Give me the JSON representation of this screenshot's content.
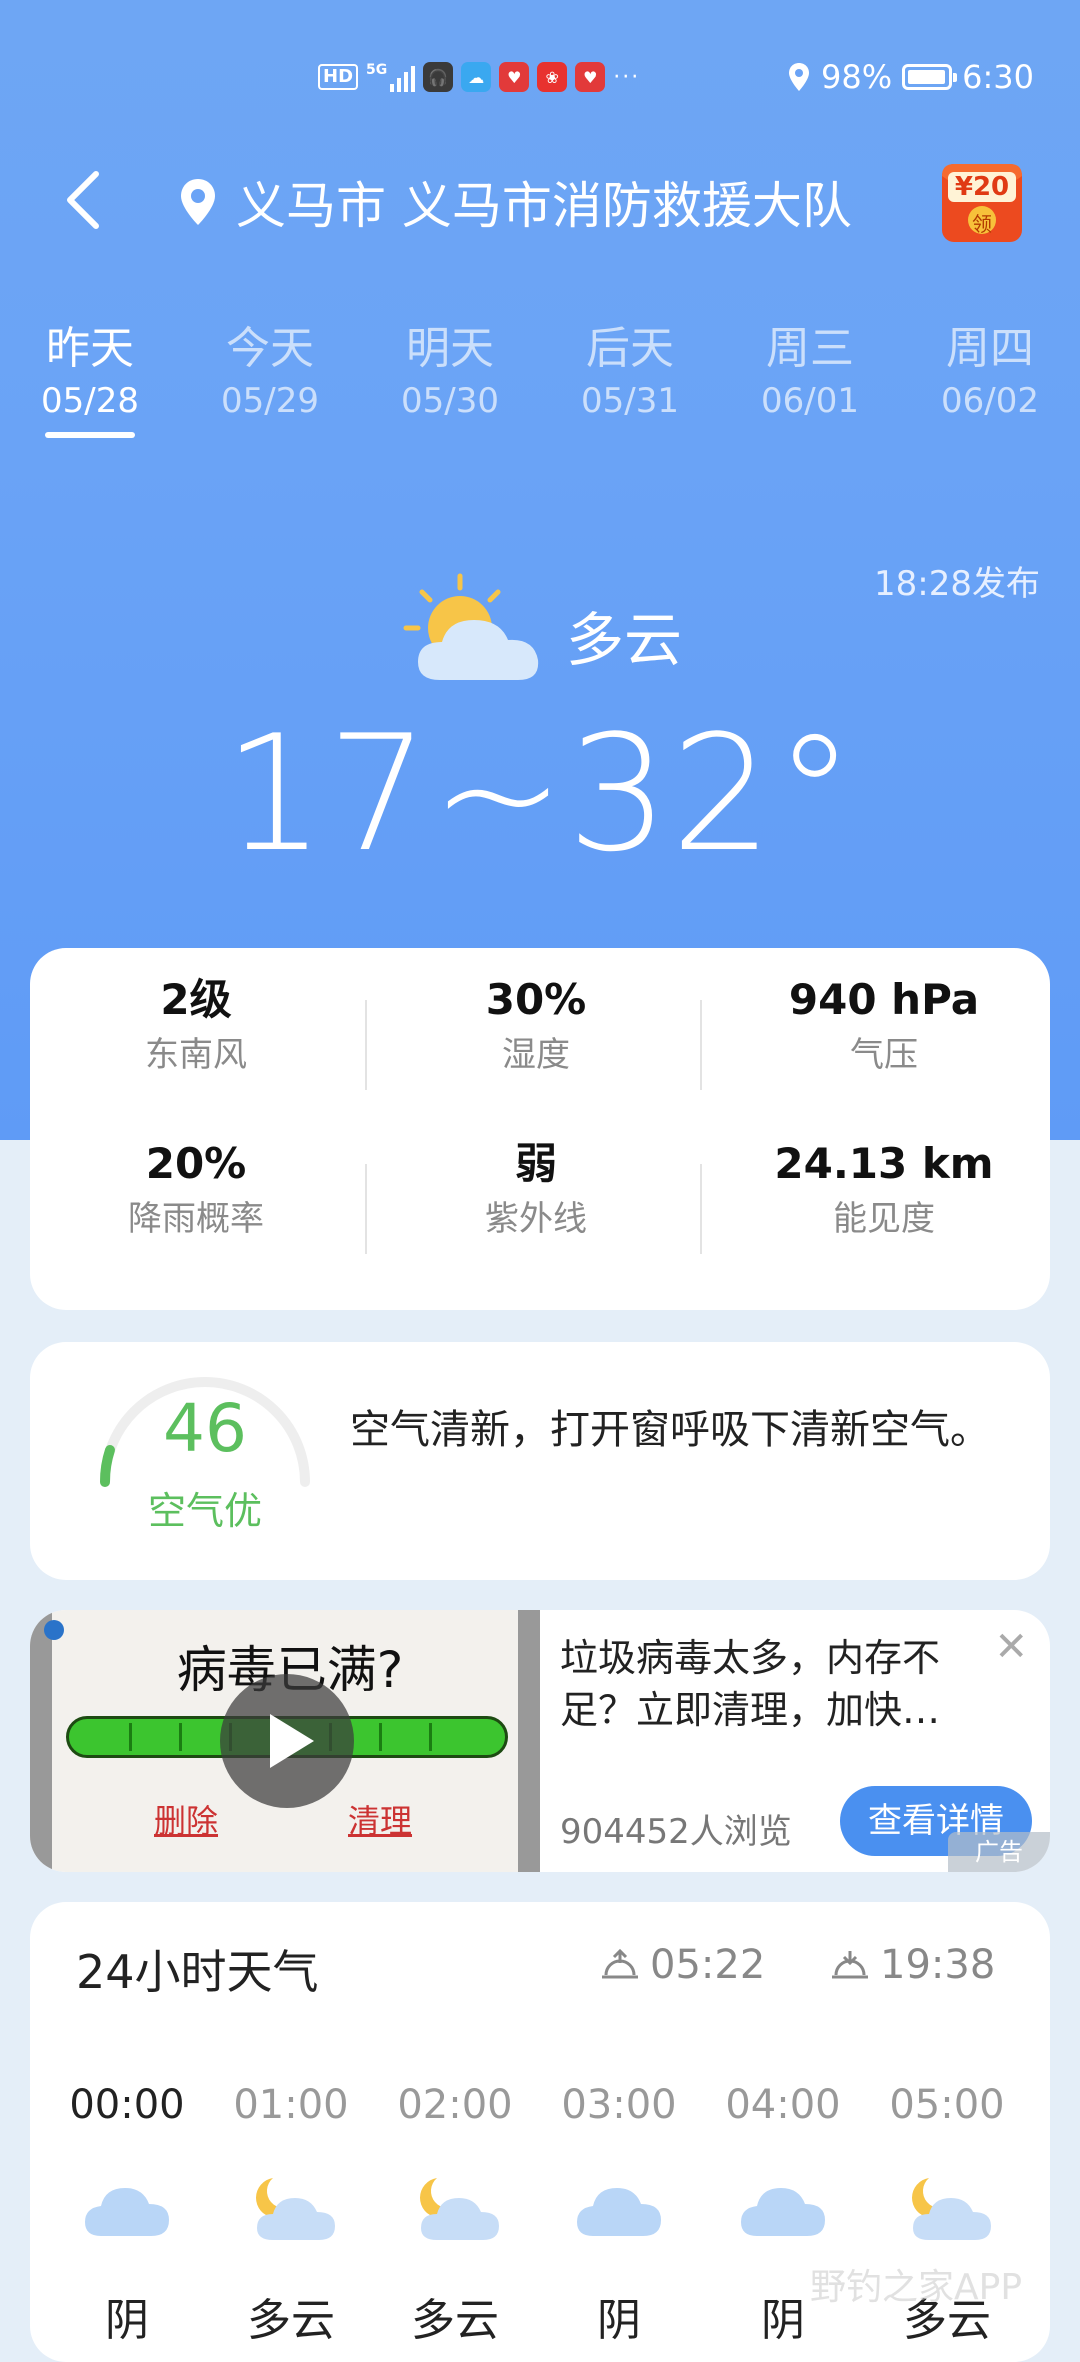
{
  "status_bar": {
    "hd": "HD",
    "network": "5G",
    "dots": "···",
    "battery": "98%",
    "battery_level": 0.98,
    "time": "6:30",
    "icons": [
      "headset-app-icon",
      "cloud-app-icon",
      "shopping-app-icon",
      "red-app-icon",
      "shopping-app-icon-2"
    ]
  },
  "header": {
    "back_icon": "chevron-left-icon",
    "location_icon": "map-pin-icon",
    "location": "义马市 义马市消防救援大队",
    "red_packet": {
      "amount": "¥20",
      "label": "领"
    }
  },
  "days": [
    {
      "name": "昨天",
      "date": "05/28",
      "active": true
    },
    {
      "name": "今天",
      "date": "05/29"
    },
    {
      "name": "明天",
      "date": "05/30"
    },
    {
      "name": "后天",
      "date": "05/31"
    },
    {
      "name": "周三",
      "date": "06/01"
    },
    {
      "name": "周四",
      "date": "06/02"
    }
  ],
  "current": {
    "publish_time": "18:28发布",
    "condition": "多云",
    "condition_icon": "partly-cloudy-icon",
    "temperature": "17~32°"
  },
  "details": [
    {
      "value": "2级",
      "label": "东南风"
    },
    {
      "value": "30%",
      "label": "湿度"
    },
    {
      "value": "940 hPa",
      "label": "气压"
    },
    {
      "value": "20%",
      "label": "降雨概率"
    },
    {
      "value": "弱",
      "label": "紫外线"
    },
    {
      "value": "24.13 km",
      "label": "能见度"
    }
  ],
  "air_quality": {
    "index": "46",
    "level": "空气优",
    "description": "空气清新，打开窗呼吸下清新空气。",
    "color": "#5cbf5e"
  },
  "ad": {
    "headline": "病毒已满?",
    "delete_label": "删除",
    "clean_label": "清理",
    "description": "垃圾病毒太多，内存不足？立即清理，加快…",
    "views": "904452人浏览",
    "button": "查看详情",
    "tag": "广告",
    "close": "✕"
  },
  "hourly": {
    "title": "24小时天气",
    "sunrise": "05:22",
    "sunset": "19:38",
    "hours": [
      {
        "time": "00:00",
        "cond": "阴",
        "icon": "cloudy-icon"
      },
      {
        "time": "01:00",
        "cond": "多云",
        "icon": "partly-cloudy-night-icon"
      },
      {
        "time": "02:00",
        "cond": "多云",
        "icon": "partly-cloudy-night-icon"
      },
      {
        "time": "03:00",
        "cond": "阴",
        "icon": "cloudy-icon"
      },
      {
        "time": "04:00",
        "cond": "阴",
        "icon": "cloudy-icon"
      },
      {
        "time": "05:00",
        "cond": "多云",
        "icon": "partly-cloudy-night-icon"
      }
    ]
  },
  "colors": {
    "accent": "#4a90f0",
    "hero": "#6aa3f6"
  }
}
